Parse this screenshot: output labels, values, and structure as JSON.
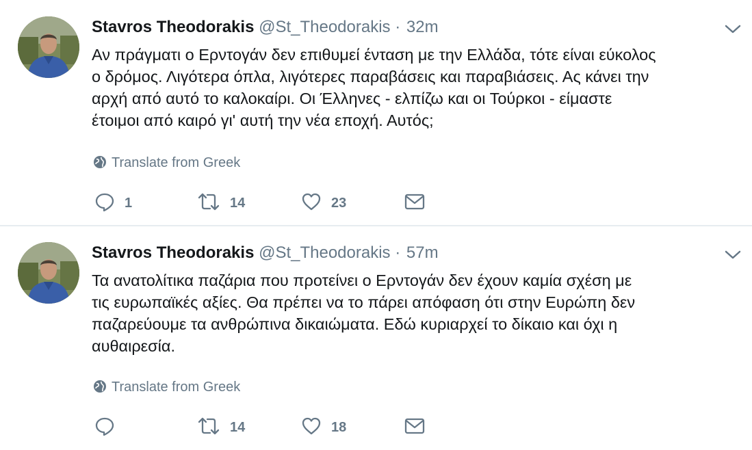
{
  "colors": {
    "name": "#14171a",
    "secondary": "#657786",
    "divider": "#e6ecf0"
  },
  "icons": [
    "avatar-photo",
    "chevron-down-icon",
    "globe-icon",
    "reply-icon",
    "retweet-icon",
    "like-heart-icon",
    "direct-message-icon"
  ],
  "tweets": [
    {
      "author_name": "Stavros Theodorakis",
      "handle": "@St_Theodorakis",
      "separator": "·",
      "time": "32m",
      "text": "Αν πράγματι ο Ερντογάν δεν επιθυμεί ένταση με την Ελλάδα, τότε είναι εύκολος\nο δρόμος. Λιγότερα όπλα, λιγότερες παραβάσεις και παραβιάσεις. Ας κάνει την\nαρχή από αυτό το καλοκαίρι. Οι Έλληνες - ελπίζω  και οι  Τούρκοι - είμαστε\nέτοιμοι από καιρό γι' αυτή την νέα εποχή. Αυτός;",
      "translate_label": "Translate from Greek",
      "replies": "1",
      "retweets": "14",
      "likes": "23"
    },
    {
      "author_name": "Stavros Theodorakis",
      "handle": "@St_Theodorakis",
      "separator": "·",
      "time": "57m",
      "text": "Τα ανατολίτικα παζάρια που προτείνει ο Ερντογάν δεν έχουν καμία σχέση με\nτις ευρωπαϊκές αξίες. Θα πρέπει να το πάρει απόφαση ότι στην Ευρώπη δεν\nπαζαρεύουμε τα ανθρώπινα δικαιώματα. Εδώ κυριαρχεί το δίκαιο και όχι η\nαυθαιρεσία.",
      "translate_label": "Translate from Greek",
      "replies": "",
      "retweets": "14",
      "likes": "18"
    }
  ]
}
